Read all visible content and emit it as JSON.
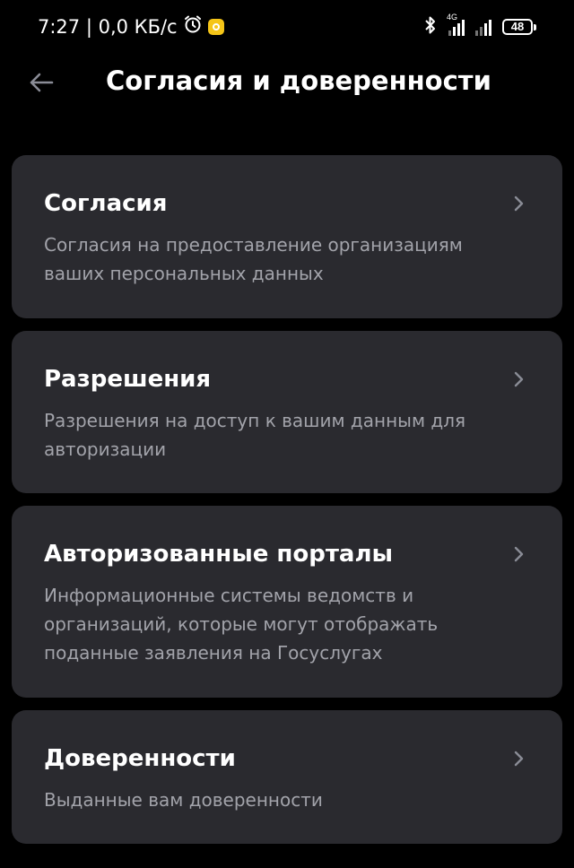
{
  "status_bar": {
    "time_net": "7:27 | 0,0 КБ/с",
    "network": "4G",
    "battery": "48"
  },
  "header": {
    "title": "Согласия и доверенности"
  },
  "cards": [
    {
      "title": "Согласия",
      "description": "Согласия на предоставление организациям ваших персональных данных"
    },
    {
      "title": "Разрешения",
      "description": "Разрешения на доступ к вашим данным для авторизации"
    },
    {
      "title": "Авторизованные порталы",
      "description": "Информационные системы ведомств и организаций, которые могут отображать поданные заявления на Госуслугах"
    },
    {
      "title": "Доверенности",
      "description": "Выданные вам доверенности"
    }
  ],
  "colors": {
    "background": "#000000",
    "card": "#2a2a2f",
    "text_primary": "#ffffff",
    "text_secondary": "#a2a3aa"
  }
}
